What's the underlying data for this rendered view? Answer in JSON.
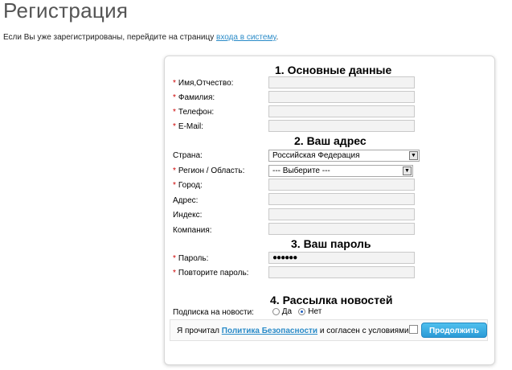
{
  "page": {
    "title": "Регистрация",
    "intro_text": "Если Вы уже зарегистрированы, перейдите на страницу",
    "intro_link": "входа в систему",
    "intro_end": "."
  },
  "sections": {
    "basic": "1. Основные данные",
    "address": "2. Ваш адрес",
    "password": "3. Ваш пароль",
    "newsletter": "4. Рассылка новостей"
  },
  "required_mark": "*",
  "fields": {
    "name": "Имя,Отчество:",
    "surname": "Фамилия:",
    "phone": "Телефон:",
    "email": "E-Mail:",
    "country": "Страна:",
    "region": "Регион / Область:",
    "city": "Город:",
    "address": "Адрес:",
    "zip": "Индекс:",
    "company": "Компания:",
    "password": "Пароль:",
    "password_confirm": "Повторите пароль:"
  },
  "values": {
    "country": "Российская Федерация",
    "region": "--- Выберите ---",
    "password_masked": "●●●●●●"
  },
  "newsletter": {
    "label": "Подписка на новости:",
    "option_yes": "Да",
    "option_no": "Нет",
    "selected": "Нет"
  },
  "agreement": {
    "text_before": "Я прочитал ",
    "link": "Политика Безопасности",
    "text_after": " и согласен с условиями",
    "checked": false
  },
  "continue_button": "Продолжить",
  "colors": {
    "accent": "#2a9ad6",
    "required": "#cc0000",
    "link": "#2a8bc8"
  }
}
